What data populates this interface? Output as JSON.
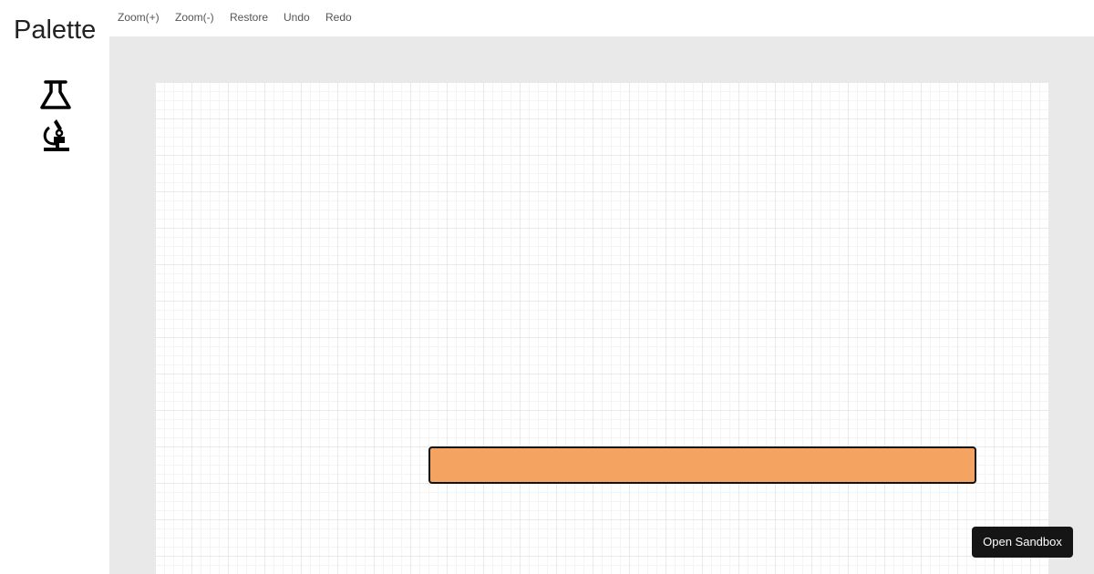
{
  "sidebar": {
    "title": "Palette",
    "items": [
      {
        "icon": "flask-icon"
      },
      {
        "icon": "microscope-icon"
      }
    ]
  },
  "toolbar": {
    "zoom_in_label": "Zoom(+)",
    "zoom_out_label": "Zoom(-)",
    "restore_label": "Restore",
    "undo_label": "Undo",
    "redo_label": "Redo"
  },
  "canvas": {
    "shape_fill": "#f4a460",
    "shape_stroke": "#111111"
  },
  "sandbox": {
    "label": "Open Sandbox"
  },
  "colors": {
    "workspace_bg": "#e9e9e9",
    "button_dark": "#151515"
  }
}
